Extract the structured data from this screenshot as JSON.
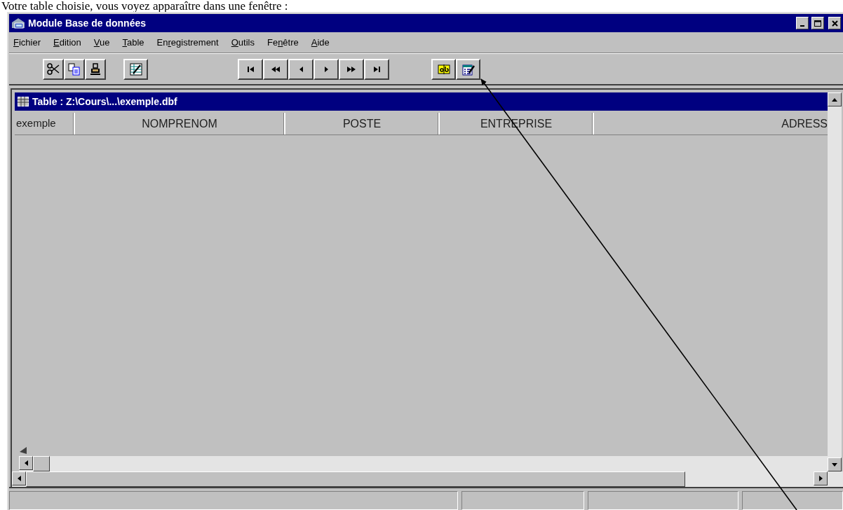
{
  "document_text": "Votre table choisie, vous voyez apparaître dans une fenêtre :",
  "window": {
    "title": "Module Base de données"
  },
  "menu": [
    {
      "mnemonic": "F",
      "after": "ichier"
    },
    {
      "mnemonic": "E",
      "after": "dition"
    },
    {
      "mnemonic": "V",
      "after": "ue"
    },
    {
      "mnemonic": "T",
      "after": "able"
    },
    {
      "before": "En",
      "mnemonic": "r",
      "after": "egistrement"
    },
    {
      "mnemonic": "O",
      "after": "utils"
    },
    {
      "before": "Fe",
      "mnemonic": "n",
      "after": "être"
    },
    {
      "mnemonic": "A",
      "after": "ide"
    }
  ],
  "toolbar": [
    {
      "buttons": [
        {
          "kind": "cut"
        },
        {
          "kind": "copy"
        },
        {
          "kind": "paste"
        }
      ]
    },
    {
      "buttons": [
        {
          "kind": "form"
        }
      ]
    },
    {
      "buttons": [
        {
          "kind": "first"
        },
        {
          "kind": "page_back"
        },
        {
          "kind": "back"
        },
        {
          "kind": "forward"
        },
        {
          "kind": "page_forward"
        },
        {
          "kind": "last"
        }
      ]
    },
    {
      "buttons": [
        {
          "kind": "field"
        },
        {
          "kind": "design"
        }
      ]
    }
  ],
  "table_window": {
    "title": "Table : Z:\\Cours\\...\\exemple.dbf",
    "row_header": "exemple",
    "columns": [
      "NOMPRENOM",
      "POSTE",
      "ENTREPRISE",
      "ADRESS"
    ]
  }
}
